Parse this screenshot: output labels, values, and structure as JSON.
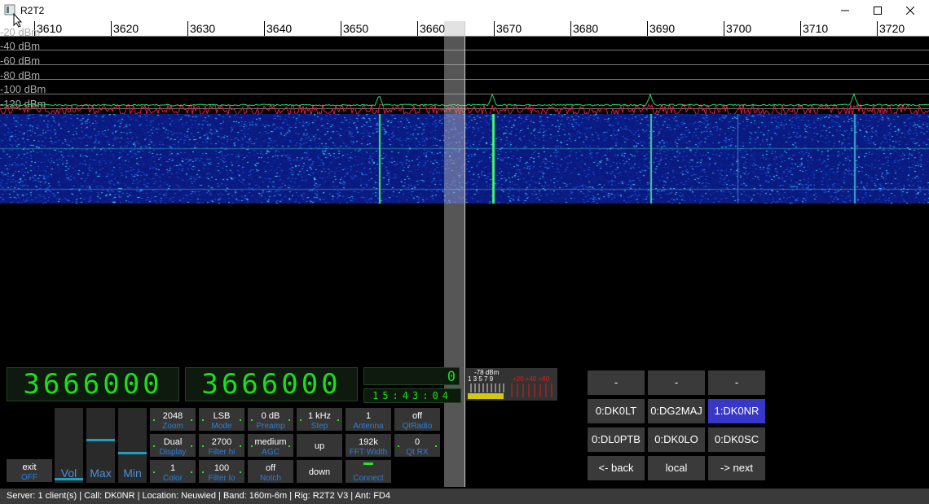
{
  "window": {
    "title": "R2T2"
  },
  "ruler": {
    "labels": [
      "3610",
      "3620",
      "3630",
      "3640",
      "3650",
      "3660",
      "3670",
      "3680",
      "3690",
      "3700",
      "3710",
      "3720"
    ]
  },
  "spectrum": {
    "dbm_labels": [
      "-20 dBm",
      "-40 dBm",
      "-60 dBm",
      "-80 dBm",
      "-100 dBm",
      "-120 dBm"
    ]
  },
  "vfo": {
    "a": "3666000",
    "b": "3666000",
    "offset": "0",
    "clock": "15:43:04"
  },
  "smeter": {
    "value": "-78 dBm",
    "scale": "1 3 5 7 9",
    "over": "+20 +40 +60"
  },
  "sliders": {
    "vol": "Vol",
    "max": "Max",
    "min": "Min"
  },
  "controls": {
    "exit": {
      "value": "exit",
      "key": "OFF"
    },
    "zoom": {
      "value": "2048",
      "key": "Zoom"
    },
    "mode": {
      "value": "LSB",
      "key": "Mode"
    },
    "preamp": {
      "value": "0 dB",
      "key": "Preamp"
    },
    "step": {
      "value": "1 kHz",
      "key": "Step"
    },
    "antenna": {
      "value": "1",
      "key": "Antenna"
    },
    "qtradio": {
      "value": "off",
      "key": "QtRadio"
    },
    "display": {
      "value": "Dual",
      "key": "Display"
    },
    "filter_hi": {
      "value": "2700",
      "key": "Filter hi"
    },
    "agc": {
      "value": "medium",
      "key": "AGC"
    },
    "up": {
      "label": "up"
    },
    "fft_width": {
      "value": "192k",
      "key": "FFT Width"
    },
    "qt_rx": {
      "value": "0",
      "key": "Qt RX"
    },
    "color": {
      "value": "1",
      "key": "Color"
    },
    "filter_lo": {
      "value": "100",
      "key": "Filter lo"
    },
    "notch": {
      "value": "off",
      "key": "Notch"
    },
    "down": {
      "label": "down"
    },
    "connect": {
      "key": "Connect"
    }
  },
  "users": {
    "row1": [
      "-",
      "-",
      "-"
    ],
    "row2": [
      "0:DK0LT",
      "0:DG2MAJ",
      "1:DK0NR"
    ],
    "row3": [
      "0:DL0PTB",
      "0:DK0LO",
      "0:DK0SC"
    ],
    "nav": {
      "back": "<- back",
      "local": "local",
      "next": "-> next"
    }
  },
  "status": "Server: 1 client(s) | Call: DK0NR | Location: Neuwied | Band: 160m-6m | Rig: R2T2 V3 | Ant: FD4",
  "colors": {
    "accent": "#2a7fd8",
    "vfo_green": "#19e019",
    "selected_user": "#3838c8",
    "spectrum_red": "#e0204a",
    "spectrum_green": "#20e060"
  }
}
